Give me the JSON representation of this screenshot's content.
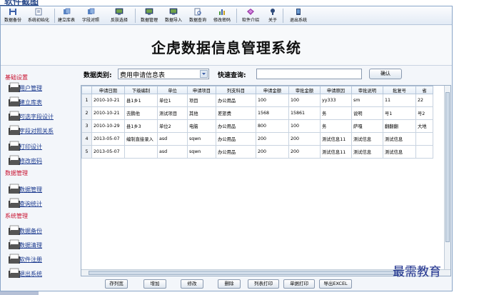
{
  "caption": "软件截图",
  "toolbar": {
    "items": [
      {
        "label": "数据备份",
        "icon": "save-disk-icon"
      },
      {
        "label": "系统初始化",
        "icon": "document-icon"
      },
      {
        "label": "建立库表",
        "icon": "database-icon"
      },
      {
        "label": "字段对照",
        "icon": "database-icon"
      },
      {
        "label": "反肤选择",
        "icon": "monitor-icon"
      },
      {
        "label": "数据管理",
        "icon": "monitor-icon"
      },
      {
        "label": "数据导入",
        "icon": "monitor-icon"
      },
      {
        "label": "数据查询",
        "icon": "search-doc-icon"
      },
      {
        "label": "修改密码",
        "icon": "chart-icon"
      },
      {
        "label": "软件介绍",
        "icon": "diamond-icon"
      },
      {
        "label": "关于",
        "icon": "help-icon"
      },
      {
        "label": "退出系统",
        "icon": "exit-icon"
      }
    ]
  },
  "banner": {
    "title": "企虎数据信息管理系统"
  },
  "sidebar": {
    "groups": [
      {
        "heading": "基础设置",
        "items": [
          "用户管理",
          "建立库表",
          "可选字段设计",
          "字段对照关系",
          "打印设计",
          "修改密码"
        ]
      },
      {
        "heading": "数据管理",
        "items": [
          "数据管理",
          "查询统计"
        ]
      },
      {
        "heading": "系统管理",
        "items": [
          "数据备份",
          "数据清理",
          "软件注册",
          "退出系统"
        ]
      }
    ]
  },
  "filter": {
    "category_label": "数据类别:",
    "category_value": "费用申请信息表",
    "search_label": "快速查询:",
    "search_value": "",
    "confirm_label": "确认"
  },
  "table": {
    "columns": [
      "申请日期",
      "下级编制",
      "单位",
      "申请项目",
      "列支科目",
      "申请金额",
      "审批金额",
      "申请原因",
      "审批说明",
      "批复号",
      "省"
    ],
    "rows": [
      {
        "n": "1",
        "cells": [
          "2010-10-21",
          "县1乡1",
          "单位1",
          "项目",
          "办公用品",
          "100",
          "100",
          "yy333",
          "sm",
          "11",
          "22"
        ]
      },
      {
        "n": "2",
        "cells": [
          "2010-10-21",
          "去鹏他",
          "测试项目",
          "其他",
          "差旅费",
          "1568",
          "15861",
          "务",
          "说明",
          "号1",
          "号2"
        ]
      },
      {
        "n": "3",
        "cells": [
          "2010-10-29",
          "县1乡3",
          "单位2",
          "电脑",
          "办公用品",
          "800",
          "100",
          "务",
          "萨嘎",
          "翻翻翻",
          "大地"
        ]
      },
      {
        "n": "4",
        "cells": [
          "2013-05-07",
          "编制直接录入",
          "asd",
          "sqwn",
          "办公用品",
          "200",
          "200",
          "测试信息11",
          "测试信息",
          "测试信息",
          ""
        ]
      },
      {
        "n": "5",
        "cells": [
          "2013-05-07",
          "",
          "asd",
          "sqwn",
          "办公用品",
          "200",
          "200",
          "测试信息11",
          "测试信息",
          "测试信息",
          ""
        ]
      }
    ]
  },
  "bottom_buttons": [
    "存列宽",
    "增加",
    "修改",
    "删除",
    "列表打印",
    "单据打印",
    "导出EXCEL"
  ],
  "watermark": "最需教育",
  "colors": {
    "accent": "#2a4a8a",
    "sidebar_heading": "#c8102e",
    "link": "#1b3a8f",
    "header_bg": "#e4ecf6"
  }
}
